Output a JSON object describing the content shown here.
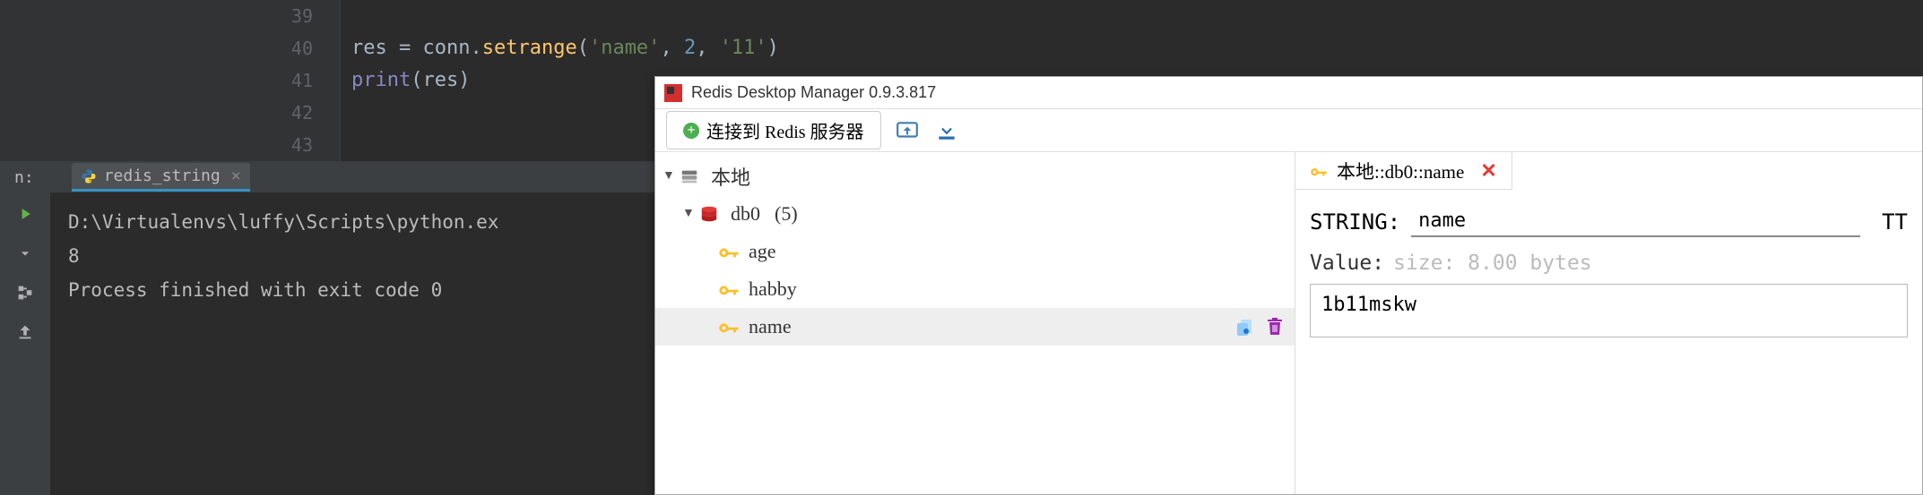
{
  "ide": {
    "line_numbers": [
      "39",
      "40",
      "41",
      "42",
      "43"
    ],
    "code": {
      "l40": {
        "var1": "res",
        "assign": " = ",
        "obj": "conn",
        "dot": ".",
        "method": "setrange",
        "p_open": "(",
        "arg1": "'name'",
        "c1": ", ",
        "arg2": "2",
        "c2": ", ",
        "arg3": "'11'",
        "p_close": ")"
      },
      "l41": {
        "func": "print",
        "p_open": "(",
        "arg": "res",
        "p_close": ")"
      }
    },
    "run": {
      "label": "n:",
      "tab_name": "redis_string",
      "output": {
        "line1": "D:\\Virtualenvs\\luffy\\Scripts\\python.ex",
        "line2": "8",
        "line3": "",
        "line4": "Process finished with exit code 0"
      }
    }
  },
  "rdm": {
    "title": "Redis Desktop Manager 0.9.3.817",
    "connect_btn": "连接到 Redis 服务器",
    "tree": {
      "server": "本地",
      "db": "db0",
      "db_count": "(5)",
      "keys": [
        "age",
        "habby",
        "name"
      ]
    },
    "detail": {
      "tab_title": "本地::db0::name",
      "type": "STRING:",
      "key_name": "name",
      "ttl_label": "TT",
      "value_label": "Value:",
      "size_hint": "size: 8.00 bytes",
      "value": "1b11mskw"
    }
  }
}
